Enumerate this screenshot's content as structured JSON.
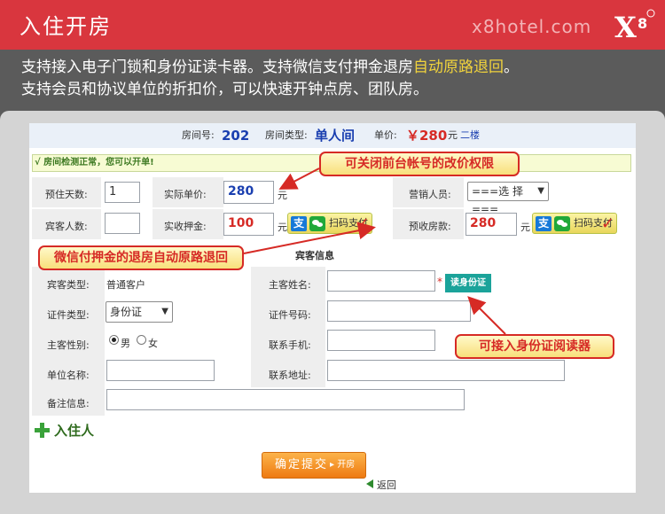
{
  "header": {
    "title": "入住开房",
    "site": "x8hotel.com",
    "logo_text": "X8"
  },
  "promo": {
    "line1_pre": "支持接入电子门锁和身份证读卡器。支持微信支付押金退房",
    "line1_hl": "自动原路退回",
    "line1_post": "。",
    "line2": "支持会员和协议单位的折扣价，可以快速开钟点房、团队房。"
  },
  "room": {
    "no_label": "房间号:",
    "no": "202",
    "type_label": "房间类型:",
    "type": "单人间",
    "price_label": "单价:",
    "price": "￥280",
    "price_unit": "元",
    "floor": "二楼"
  },
  "status": "√ 房间检测正常，您可以开单!",
  "stay": {
    "days_label": "预住天数:",
    "days": "1",
    "actual_label": "实际单价:",
    "actual": "280",
    "actual_unit": "元",
    "sales_label": "营销人员:",
    "sales": "===选 择===",
    "guests_label": "宾客人数:",
    "guests": "",
    "deposit_label": "实收押金:",
    "deposit": "100",
    "deposit_unit": "元",
    "prepay_label": "预收房款:",
    "prepay": "280",
    "prepay_unit": "元",
    "pay_label": "扫码支付",
    "alipay_glyph": "支"
  },
  "guest": {
    "section": "宾客信息",
    "type_label": "宾客类型:",
    "type": "普通客户",
    "name_label": "主客姓名:",
    "name": "",
    "required": "*",
    "read_id": "读身份证",
    "idtype_label": "证件类型:",
    "idtype": "身份证",
    "idno_label": "证件号码:",
    "idno": "",
    "gender_label": "主客性别:",
    "male": "男",
    "female": "女",
    "phone_label": "联系手机:",
    "phone": "",
    "org_label": "单位名称:",
    "org": "",
    "address_label": "联系地址:",
    "address": "",
    "note_label": "备注信息:",
    "note": ""
  },
  "actions": {
    "add_guest": "入住人",
    "submit": "确定提交",
    "submit_sub": "▸ 开房",
    "back": "返回"
  },
  "callouts": {
    "price_lock": "可关闭前台帐号的改价权限",
    "refund": "微信付押金的退房自动原路退回",
    "id_reader": "可接入身份证阅读器"
  },
  "colors": {
    "header": "#d9363e",
    "accent_blue": "#1a3fb0",
    "accent_red": "#d62a25",
    "teal": "#1ba39a"
  }
}
